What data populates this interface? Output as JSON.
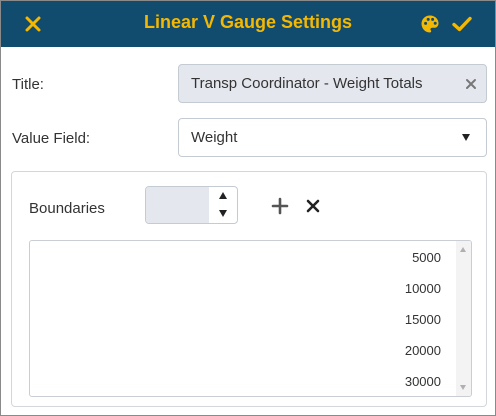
{
  "dialog": {
    "title": "Linear V Gauge Settings",
    "colors": {
      "header_bg": "#114b6e",
      "accent": "#f5b800"
    },
    "icons": {
      "close": "close-icon",
      "palette": "palette-icon",
      "save": "check-icon"
    }
  },
  "form": {
    "title_label": "Title:",
    "title_value": "Transp Coordinator - Weight Totals",
    "value_field_label": "Value Field:",
    "value_field_value": "Weight"
  },
  "boundaries": {
    "label": "Boundaries",
    "input_value": "",
    "items": [
      "5000",
      "10000",
      "15000",
      "20000",
      "30000"
    ]
  }
}
